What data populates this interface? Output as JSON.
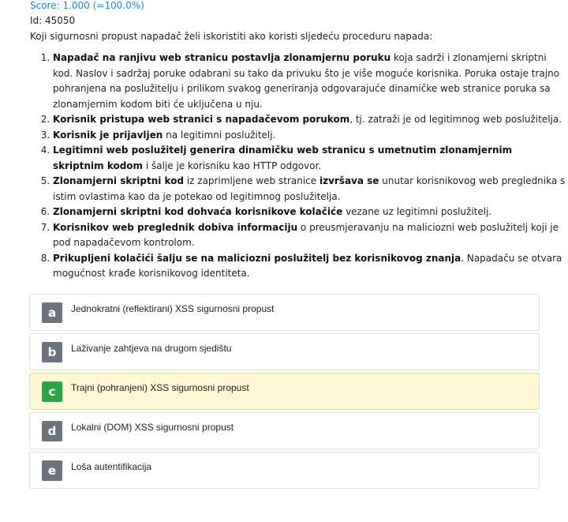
{
  "score": "Score: 1.000 (=100.0%)",
  "id": "Id: 45050",
  "question": "Koji sigurnosni propust napadač želi iskoristiti ako koristi sljedeću proceduru napada:",
  "steps": [
    {
      "bold": "Napadač na ranjivu web stranicu postavlja zlonamjernu poruku",
      "rest": " koja sadrži i zlonamjerni skriptni kod. Naslov i sadržaj poruke odabrani su tako da privuku što je više moguće korisnika. Poruka ostaje trajno pohranjena na poslužitelju i prilikom svakog generiranja odgovarajuće dinamičke web stranice poruka sa zlonamjernim kodom biti će uključena u nju."
    },
    {
      "bold": "Korisnik pristupa web stranici s napadačevom porukom",
      "rest": ", tj. zatraži je od legitimnog web poslužitelja."
    },
    {
      "bold": "Korisnik je prijavljen",
      "rest": " na legitimni poslužitelj."
    },
    {
      "bold": "Legitimni web poslužitelj generira dinamičku web stranicu s umetnutim zlonamjernim skriptnim kodom",
      "rest": " i šalje je korisniku kao HTTP odgovor."
    },
    {
      "bold": "Zlonamjerni skriptni kod",
      "rest": " iz zaprimljene web stranice ",
      "bold2": "izvršava se",
      "rest2": " unutar korisnikovog web preglednika s istim ovlastima kao da je potekao od legitimnog poslužitelja."
    },
    {
      "bold": "Zlonamjerni skriptni kod dohvaća korisnikove kolačiće",
      "rest": " vezane uz legitimni poslužitelj."
    },
    {
      "bold": "Korisnikov web preglednik dobiva informaciju",
      "rest": " o preusmjeravanju na maliciozni web poslužitelj koji je pod napadačevom kontrolom."
    },
    {
      "bold": "Prikupljeni kolačići šalju se na maliciozni poslužitelj bez korisnikovog znanja",
      "rest": ". Napadaču se otvara mogućnost krađe korisnikovog identiteta."
    }
  ],
  "options": [
    {
      "letter": "a",
      "text": "Jednokratni (reflektirani) XSS sigurnosni propust",
      "correct": false
    },
    {
      "letter": "b",
      "text": "Laživanje zahtjeva na drugom sjedištu",
      "correct": false
    },
    {
      "letter": "c",
      "text": "Trajni (pohranjeni) XSS sigurnosni propust",
      "correct": true
    },
    {
      "letter": "d",
      "text": "Lokalni (DOM) XSS sigurnosni propust",
      "correct": false
    },
    {
      "letter": "e",
      "text": "Loša autentifikacija",
      "correct": false
    }
  ],
  "colors": {
    "score": "#1a8ad8",
    "letter_default": "#6c757d",
    "letter_correct": "#28a745",
    "correct_bg": "#fdf8d4"
  }
}
